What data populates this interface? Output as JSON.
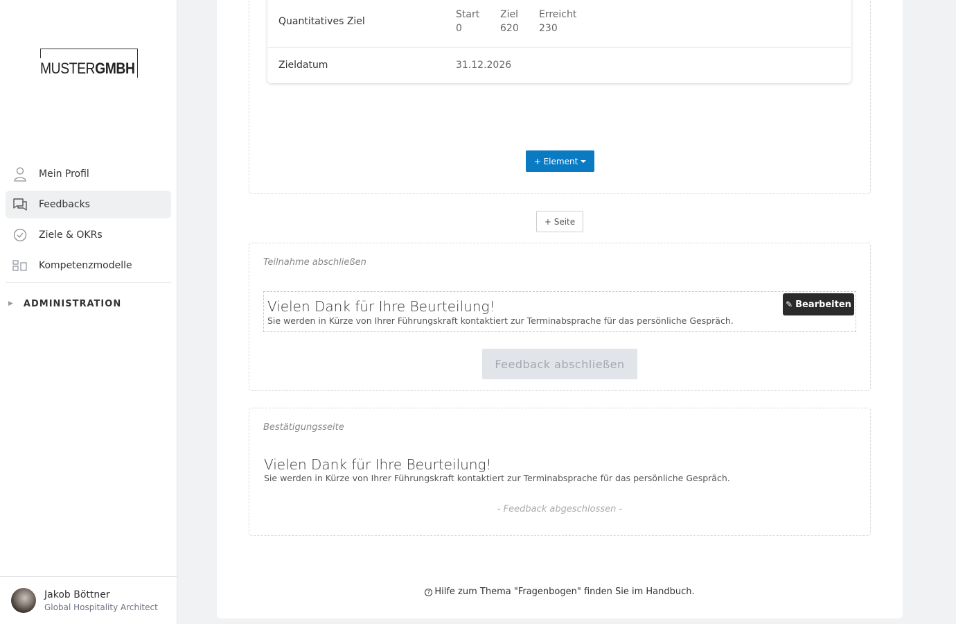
{
  "logo": {
    "light": "MUSTER",
    "bold": "GMBH"
  },
  "nav": {
    "items": [
      {
        "label": "Mein Profil"
      },
      {
        "label": "Feedbacks"
      },
      {
        "label": "Ziele & OKRs"
      },
      {
        "label": "Kompetenzmodelle"
      }
    ],
    "admin_label": "ADMINISTRATION"
  },
  "user": {
    "name": "Jakob Böttner",
    "role": "Global Hospitality Architect"
  },
  "goal": {
    "quantitative_label": "Quantitatives Ziel",
    "start_label": "Start",
    "start_value": "0",
    "target_label": "Ziel",
    "target_value": "620",
    "reached_label": "Erreicht",
    "reached_value": "230",
    "date_label": "Zieldatum",
    "date_value": "31.12.2026"
  },
  "buttons": {
    "element": "+ Element",
    "seite": "+ Seite",
    "edit": "Bearbeiten",
    "finish": "Feedback abschließen"
  },
  "participation": {
    "title": "Teilnahme abschließen",
    "heading": "Vielen Dank für Ihre Beurteilung!",
    "text": "Sie werden in Kürze von Ihrer Führungskraft kontaktiert zur Terminabsprache für das persönliche Gespräch."
  },
  "confirmation": {
    "title": "Bestätigungsseite",
    "heading": "Vielen Dank für Ihre Beurteilung!",
    "text": "Sie werden in Kürze von Ihrer Führungskraft kontaktiert zur Terminabsprache für das persönliche Gespräch.",
    "closed_note": "- Feedback abgeschlossen -"
  },
  "help": {
    "text": "Hilfe zum Thema \"Fragenbogen\" finden Sie im Handbuch."
  }
}
